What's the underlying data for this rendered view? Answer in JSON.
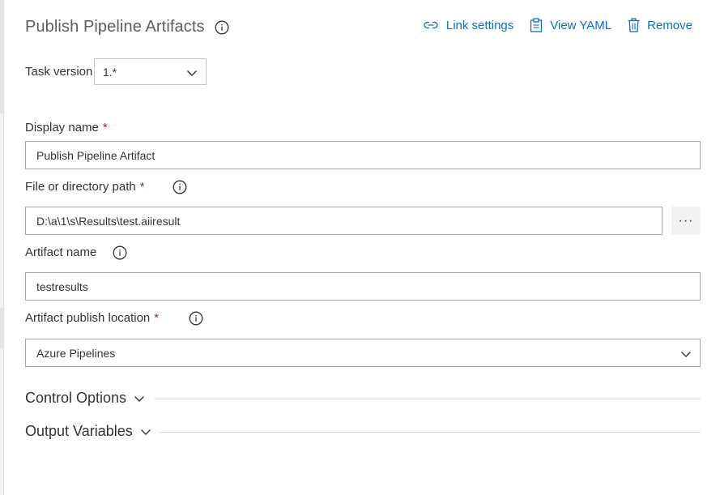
{
  "header": {
    "title": "Publish Pipeline Artifacts",
    "info_icon": "info-icon"
  },
  "actions": [
    {
      "label": "Link settings",
      "icon": "link-icon"
    },
    {
      "label": "View YAML",
      "icon": "clipboard-icon"
    },
    {
      "label": "Remove",
      "icon": "trash-icon"
    }
  ],
  "task_version": {
    "label": "Task version",
    "value": "1.*"
  },
  "fields": {
    "display_name": {
      "label": "Display name",
      "required": "*",
      "value": "Publish Pipeline Artifact"
    },
    "path": {
      "label": "File or directory path",
      "required": "*",
      "value": "D:\\a\\1\\s\\Results\\test.aiiresult",
      "browse_label": "···"
    },
    "artifact_name": {
      "label": "Artifact name",
      "value": "testresults"
    },
    "publish_location": {
      "label": "Artifact publish location",
      "required": "*",
      "value": "Azure Pipelines"
    }
  },
  "sections": {
    "control_options": "Control Options",
    "output_variables": "Output Variables"
  },
  "colors": {
    "accent": "#106ebe",
    "required": "#a4262c",
    "title": "#605e5c"
  }
}
